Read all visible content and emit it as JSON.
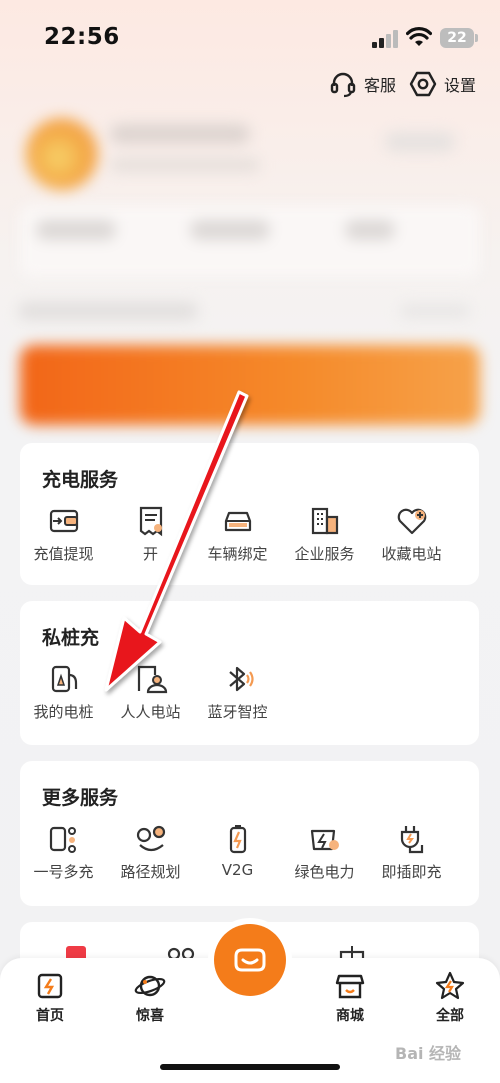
{
  "status_bar": {
    "time": "22:56",
    "battery": "22"
  },
  "header": {
    "service_label": "客服",
    "settings_label": "设置"
  },
  "charging_services": {
    "title": "充电服务",
    "items": [
      {
        "label": "充值提现",
        "icon": "wallet-icon"
      },
      {
        "label": "开",
        "icon": "invoice-icon"
      },
      {
        "label": "车辆绑定",
        "icon": "car-icon"
      },
      {
        "label": "企业服务",
        "icon": "building-icon"
      },
      {
        "label": "收藏电站",
        "icon": "heart-plus-icon"
      }
    ]
  },
  "private_pile": {
    "title": "私桩充",
    "items": [
      {
        "label": "我的电桩",
        "icon": "charger-icon"
      },
      {
        "label": "人人电站",
        "icon": "person-station-icon"
      },
      {
        "label": "蓝牙智控",
        "icon": "bluetooth-icon"
      }
    ]
  },
  "more_services": {
    "title": "更多服务",
    "items": [
      {
        "label": "一号多充",
        "icon": "phone-multi-icon"
      },
      {
        "label": "路径规划",
        "icon": "route-icon"
      },
      {
        "label": "V2G",
        "icon": "battery-icon"
      },
      {
        "label": "绿色电力",
        "icon": "green-power-icon"
      },
      {
        "label": "即插即充",
        "icon": "plug-icon"
      }
    ]
  },
  "bottom_nav": {
    "items": [
      {
        "label": "首页",
        "icon": "home-bolt-icon"
      },
      {
        "label": "惊喜",
        "icon": "planet-icon"
      },
      {
        "label": "商城",
        "icon": "shop-icon"
      },
      {
        "label": "全部",
        "icon": "star-bolt-icon"
      }
    ]
  },
  "watermark": "Bai 经验",
  "colors": {
    "accent": "#f47c1a",
    "arrow": "#e8141b",
    "card_bg": "#ffffff"
  }
}
